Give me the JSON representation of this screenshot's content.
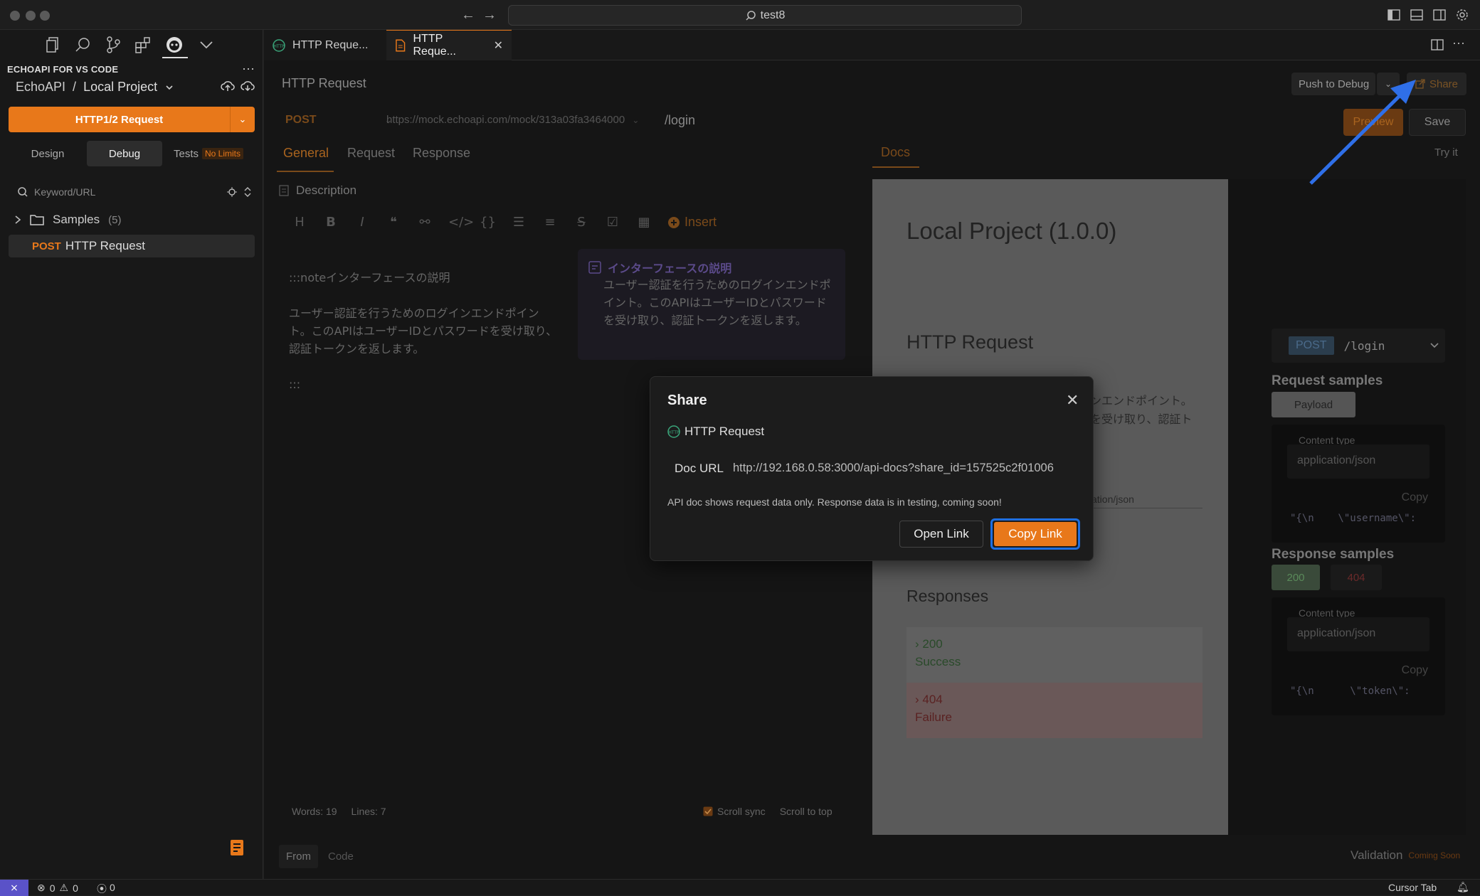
{
  "window": {
    "search_text": "test8"
  },
  "sidebar": {
    "title": "ECHOAPI FOR VS CODE",
    "breadcrumb_root": "EchoAPI",
    "breadcrumb_sep": "/",
    "breadcrumb_project": "Local Project",
    "new_request_label": "HTTP1/2 Request",
    "mode_tabs": [
      "Design",
      "Debug",
      "Tests"
    ],
    "active_mode": "Debug",
    "tests_badge": "No Limits",
    "search_placeholder": "Keyword/URL",
    "folder_name": "Samples",
    "folder_count": "(5)",
    "request_method": "POST",
    "request_name": "HTTP Request"
  },
  "tabs": [
    {
      "label": "HTTP Reque...",
      "active": false
    },
    {
      "label": "HTTP Reque...",
      "active": true
    }
  ],
  "request": {
    "title": "HTTP Request",
    "push_label": "Push to Debug",
    "share_label": "Share",
    "method": "POST",
    "url": "https://mock.echoapi.com/mock/313a03fa3464000",
    "path": "/login",
    "preview_label": "Preview",
    "save_label": "Save",
    "sub_tabs": [
      "General",
      "Request",
      "Response"
    ],
    "active_sub_tab": "General",
    "docs_tab": "Docs",
    "try_it": "Try it",
    "description_label": "Description",
    "insert_label": "Insert",
    "md_lines": [
      ":::noteインターフェースの説明",
      "ユーザー認証を行うためのログインエンドポイント。このAPIはユーザーIDとパスワードを受け取り、認証トークンを返します。",
      ":::"
    ],
    "note_title": "インターフェースの説明",
    "note_body": "ユーザー認証を行うためのログインエンドポイント。このAPIはユーザーIDとパスワードを受け取り、認証トークンを返します。",
    "words": "Words: 19",
    "lines": "Lines: 7",
    "scroll_sync": "Scroll sync",
    "scroll_top": "Scroll to top",
    "bottom_tabs": [
      "From",
      "Code"
    ],
    "validation": "Validation",
    "coming_soon": "Coming Soon"
  },
  "docs": {
    "project_title": "Local Project (1.0.0)",
    "endpoint_title": "HTTP Request",
    "desc_fragment_1": "ンエンドポイント。",
    "desc_fragment_2": "を受け取り、認証ト",
    "content_type_fragment": "ation/json",
    "responses_title": "Responses",
    "responses": [
      {
        "code": "200",
        "label": "Success"
      },
      {
        "code": "404",
        "label": "Failure"
      }
    ],
    "side_method": "POST",
    "side_path": "/login",
    "request_samples": "Request samples",
    "payload": "Payload",
    "content_type_label": "Content type",
    "content_type_value": "application/json",
    "copy": "Copy",
    "req_code": "\"{\\n    \\\"username\\\":",
    "response_samples": "Response samples",
    "resp_code": "\"{\\n      \\\"token\\\":"
  },
  "dialog": {
    "title": "Share",
    "request_name": "HTTP Request",
    "doc_url_label": "Doc URL",
    "doc_url": "http://192.168.0.58:3000/api-docs?share_id=157525c2f01006",
    "note": "API doc shows request data only. Response data is in testing, coming soon!",
    "open_link": "Open Link",
    "copy_link": "Copy Link"
  },
  "status": {
    "errors": "0",
    "warnings": "0",
    "ports": "0",
    "cursor_tab": "Cursor Tab"
  },
  "colors": {
    "accent": "#e8781a",
    "annotation_arrow": "#2f6fe8",
    "focus_ring": "#1f6fe0"
  }
}
